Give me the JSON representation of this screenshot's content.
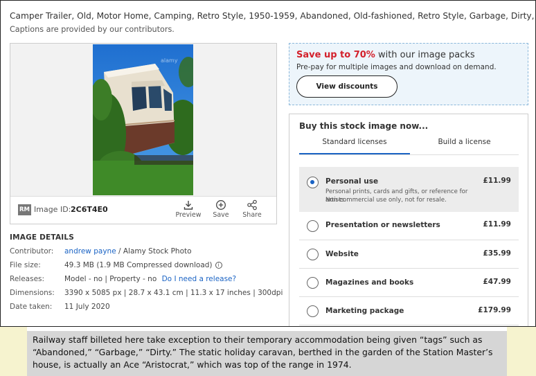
{
  "keywords": "Camper Trailer, Old, Motor Home, Camping, Retro Style, 1950-1959, Abandoned, Old-fashioned, Retro Style, Garbage, Dirty, Vehicle Trailer,",
  "captions_note": "Captions are provided by our contributors.",
  "image": {
    "watermark": "alamy",
    "badge": "RM",
    "id_label": "Image ID:",
    "id_value": "2C6T4E0",
    "actions": [
      {
        "label": "Preview",
        "icon": "download-icon"
      },
      {
        "label": "Save",
        "icon": "plus-circle-icon"
      },
      {
        "label": "Share",
        "icon": "share-icon"
      }
    ]
  },
  "details": {
    "title": "IMAGE DETAILS",
    "contributor_label": "Contributor:",
    "contributor_link": "andrew payne",
    "contributor_rest": " / Alamy Stock Photo",
    "filesize_label": "File size:",
    "filesize_value": "49.3 MB (1.9 MB Compressed download)",
    "releases_label": "Releases:",
    "releases_value": "Model - no | Property - no ",
    "releases_link": "Do I need a release?",
    "dimensions_label": "Dimensions:",
    "dimensions_value": "3390 x 5085 px | 28.7 x 43.1 cm | 11.3 x 17 inches | 300dpi",
    "date_label": "Date taken:",
    "date_value": "11 July 2020"
  },
  "promo": {
    "title_red": "Save up to 70%",
    "title_rest": " with our image packs",
    "subtitle": "Pre-pay for multiple images and download on demand.",
    "button": "View discounts"
  },
  "buy": {
    "title": "Buy this stock image now...",
    "tabs": [
      "Standard licenses",
      "Build a license"
    ],
    "options": [
      {
        "name": "Personal use",
        "price": "£11.99",
        "selected": true,
        "desc1": "Personal prints, cards and gifts, or reference for artists.",
        "desc2": "Non-commercial use only, not for resale."
      },
      {
        "name": "Presentation or newsletters",
        "price": "£11.99",
        "selected": false
      },
      {
        "name": "Website",
        "price": "£35.99",
        "selected": false
      },
      {
        "name": "Magazines and books",
        "price": "£47.99",
        "selected": false
      },
      {
        "name": "Marketing package",
        "price": "£179.99",
        "selected": false
      }
    ]
  },
  "caption": "Railway staff billeted here take exception to their temporary accommodation being given “tags” such as “Abandoned,” “Garbage,” “Dirty.” The static holiday caravan, berthed in the garden of the Station Master’s house, is actually an Ace “Aristocrat,” which was top of the range in 1974.",
  "colors": {
    "accent_blue": "#1a63c4",
    "promo_red": "#d3202b",
    "promo_bg": "#edf5fb",
    "caption_bg": "#d6d6d6",
    "outer_bg": "#f6f3cf"
  }
}
